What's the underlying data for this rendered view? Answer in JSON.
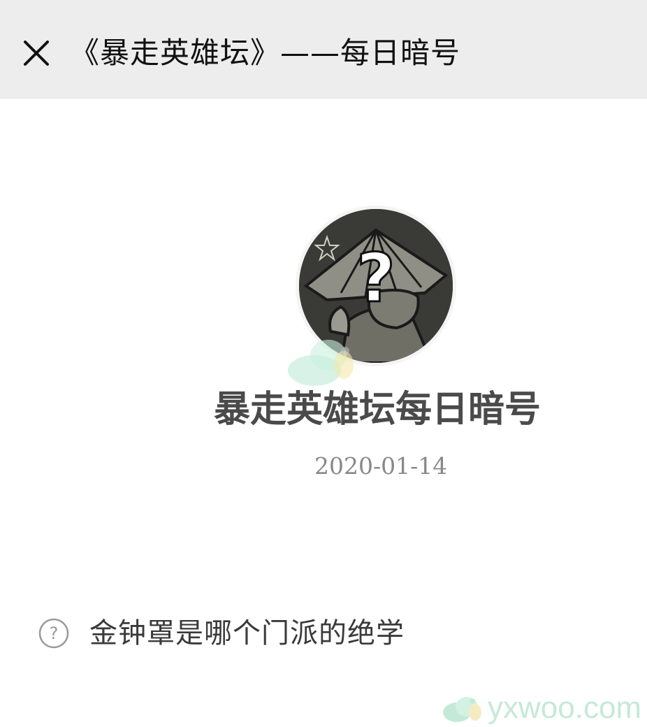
{
  "header": {
    "close_icon": "close-icon",
    "title": "《暴走英雄坛》——每日暗号"
  },
  "account": {
    "avatar_icon": "avatar-question-mark",
    "name": "暴走英雄坛每日暗号",
    "date": "2020-01-14"
  },
  "question": {
    "icon": "help-circle-icon",
    "text": "金钟罩是哪个门派的绝学"
  },
  "watermark": {
    "text": "yxwoo.com"
  },
  "colors": {
    "topbar_bg": "#ededed",
    "title_text": "#111111",
    "name_text": "#4a4a4a",
    "date_text": "#888888",
    "watermark": "#9fdcc0"
  }
}
